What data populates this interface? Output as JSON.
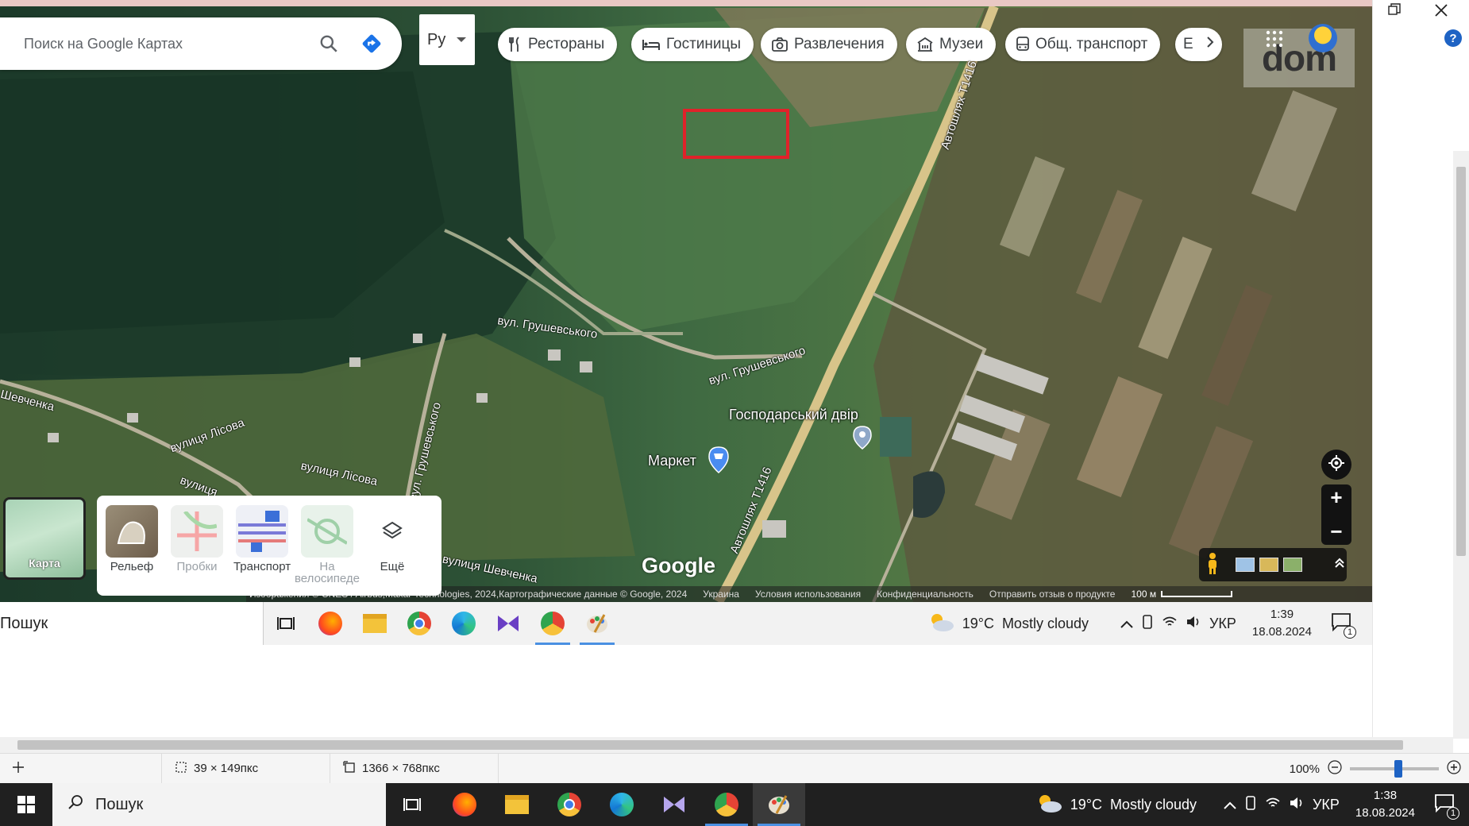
{
  "search": {
    "placeholder": "Поиск на Google Картах"
  },
  "lang": {
    "label": "Ру"
  },
  "chips": [
    {
      "label": "Рестораны",
      "icon": "fork-knife-icon"
    },
    {
      "label": "Гостиницы",
      "icon": "bed-icon"
    },
    {
      "label": "Развлечения",
      "icon": "camera-icon"
    },
    {
      "label": "Музеи",
      "icon": "museum-icon"
    },
    {
      "label": "Общ. транспорт",
      "icon": "bus-icon"
    }
  ],
  "chip_more": "Е",
  "map": {
    "streets": [
      "вул. Грушевського",
      "вул. Грушевського",
      "Автошлях Т1416",
      "Автошлях Т1416",
      "вулиця Лісова",
      "вулиця Лісова",
      "вул. Грушевського",
      "Шевченка",
      "вулиця Шевченка",
      "вулиця"
    ],
    "poi": [
      "Господарський двір",
      "Маркет"
    ],
    "brand": "Google",
    "watermark": "dom"
  },
  "attribution": {
    "imagery": "Изображения © CNES / Airbus,Maxar Technologies, 2024,Картографические данные © Google, 2024",
    "country": "Украина",
    "terms": "Условия использования",
    "privacy": "Конфиденциальность",
    "feedback": "Отправить отзыв о продукте",
    "scale": "100 м"
  },
  "layers": {
    "base": "Карта",
    "items": [
      "Рельеф",
      "Пробки",
      "Транспорт",
      "На велосипеде",
      "Ещё"
    ]
  },
  "inner_taskbar": {
    "search": "Пошук",
    "temp": "19°C",
    "weather": "Mostly cloudy",
    "lang": "УКР",
    "time": "1:39",
    "date": "18.08.2024",
    "notif": "1"
  },
  "status": {
    "selection": "39 × 149пкс",
    "image_size": "1366 × 768пкс",
    "zoom": "100%"
  },
  "outer_taskbar": {
    "search": "Пошук",
    "temp": "19°C",
    "weather": "Mostly cloudy",
    "lang": "УКР",
    "time": "1:38",
    "date": "18.08.2024",
    "notif": "1"
  }
}
